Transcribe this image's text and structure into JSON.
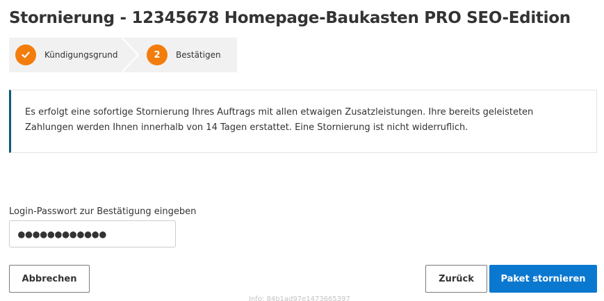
{
  "page_title": "Stornierung - 12345678 Homepage-Baukasten PRO SEO-Edition",
  "wizard": {
    "steps": [
      {
        "number": "",
        "label": "Kündigungsgrund",
        "state": "completed",
        "icon": "check-icon"
      },
      {
        "number": "2",
        "label": "Bestätigen",
        "state": "active"
      }
    ],
    "accent_color": "#f37d0c"
  },
  "info_box": {
    "text": "Es erfolgt eine sofortige Stornierung Ihres Auftrags mit allen etwaigen Zusatzleistungen. Ihre bereits geleisteten Zahlungen werden Ihnen innerhalb von 14 Tagen erstattet. Eine Stornierung ist nicht widerruflich.",
    "accent_color": "#0b5a7c"
  },
  "password": {
    "label": "Login-Passwort zur Bestätigung eingeben",
    "value": "●●●●●●●●●●●●"
  },
  "buttons": {
    "cancel_label": "Abbrechen",
    "back_label": "Zurück",
    "submit_label": "Paket stornieren",
    "submit_color": "#0b78d0"
  },
  "footer": {
    "info": "Info: 84b1ad97e1473665397"
  }
}
